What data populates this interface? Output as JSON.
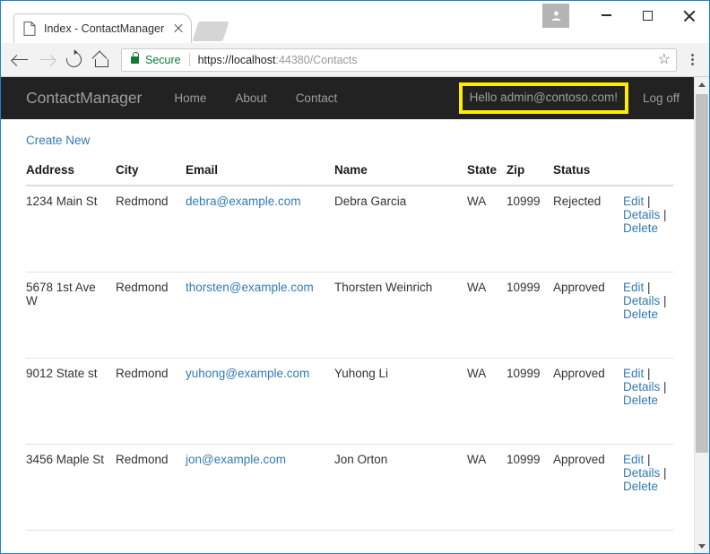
{
  "browser": {
    "tab": {
      "title": "Index - ContactManager",
      "favicon_icon": "page-icon",
      "close_icon": "close-icon"
    },
    "new_tab_icon": "new-tab-icon",
    "window_controls": {
      "profile_icon": "person-icon",
      "minimize_icon": "minimize-icon",
      "maximize_icon": "maximize-icon",
      "close_icon": "close-icon"
    },
    "toolbar": {
      "back_icon": "back-arrow-icon",
      "forward_icon": "forward-arrow-icon",
      "reload_icon": "reload-icon",
      "home_icon": "home-icon",
      "lock_icon": "lock-icon",
      "security_label": "Secure",
      "url_host": "https://localhost",
      "url_rest": ":44380/Contacts",
      "bookmark_icon": "star-icon",
      "menu_icon": "kebab-menu-icon"
    }
  },
  "site": {
    "brand": "ContactManager",
    "nav": [
      {
        "label": "Home"
      },
      {
        "label": "About"
      },
      {
        "label": "Contact"
      }
    ],
    "greeting": "Hello admin@contoso.com!",
    "greeting_highlight_color": "#ffec00",
    "logoff": "Log off"
  },
  "page": {
    "create_new": "Create New",
    "table": {
      "columns": [
        "Address",
        "City",
        "Email",
        "Name",
        "State",
        "Zip",
        "Status",
        ""
      ],
      "actions": {
        "edit": "Edit",
        "details": "Details",
        "delete": "Delete",
        "separator": "|"
      },
      "rows": [
        {
          "address": "1234 Main St",
          "city": "Redmond",
          "email": "debra@example.com",
          "name": "Debra Garcia",
          "state": "WA",
          "zip": "10999",
          "status": "Rejected"
        },
        {
          "address": "5678 1st Ave W",
          "city": "Redmond",
          "email": "thorsten@example.com",
          "name": "Thorsten Weinrich",
          "state": "WA",
          "zip": "10999",
          "status": "Approved"
        },
        {
          "address": "9012 State st",
          "city": "Redmond",
          "email": "yuhong@example.com",
          "name": "Yuhong Li",
          "state": "WA",
          "zip": "10999",
          "status": "Approved"
        },
        {
          "address": "3456 Maple St",
          "city": "Redmond",
          "email": "jon@example.com",
          "name": "Jon Orton",
          "state": "WA",
          "zip": "10999",
          "status": "Approved"
        }
      ]
    }
  },
  "scrollbar": {
    "up_icon": "scroll-up-arrow-icon",
    "down_icon": "scroll-down-arrow-icon"
  },
  "theme": {
    "link_color": "#337ab7",
    "navbar_bg": "#222222",
    "navbar_text": "#9d9d9d",
    "secure_green": "#0e7a32",
    "window_border": "#1a82d6"
  }
}
